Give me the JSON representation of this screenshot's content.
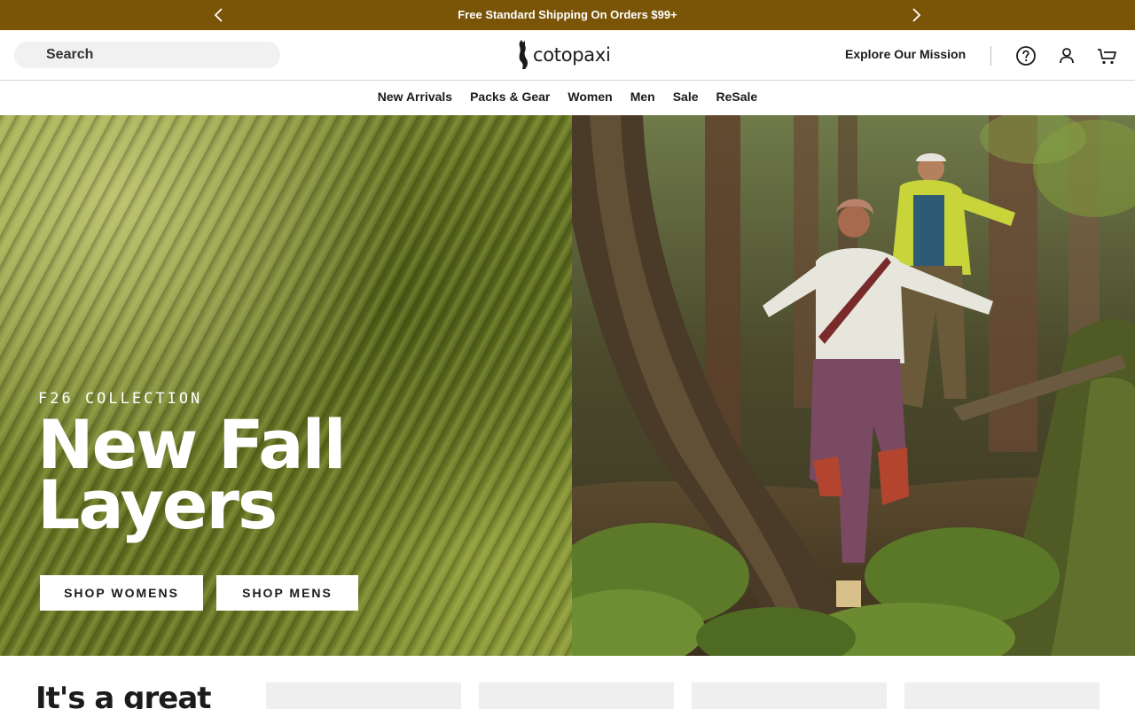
{
  "announcement": {
    "text": "Free Standard Shipping On Orders $99+",
    "prev_icon": "chevron-left-icon",
    "next_icon": "chevron-right-icon"
  },
  "header": {
    "search_placeholder": "Search",
    "logo_text": "cotopaxi",
    "mission_link": "Explore Our Mission",
    "icons": [
      "help-icon",
      "account-icon",
      "cart-icon"
    ]
  },
  "nav": {
    "items": [
      {
        "label": "New Arrivals"
      },
      {
        "label": "Packs & Gear"
      },
      {
        "label": "Women"
      },
      {
        "label": "Men"
      },
      {
        "label": "Sale"
      },
      {
        "label": "ReSale"
      }
    ]
  },
  "hero": {
    "eyebrow": "F26 COLLECTION",
    "headline": "New Fall Layers",
    "button_women": "SHOP WOMENS",
    "button_men": "SHOP MENS"
  },
  "section": {
    "title": "It's a great"
  },
  "colors": {
    "announcement_bg": "#7a5508",
    "text": "#1b1b1b",
    "search_bg": "#f1f1f1"
  }
}
